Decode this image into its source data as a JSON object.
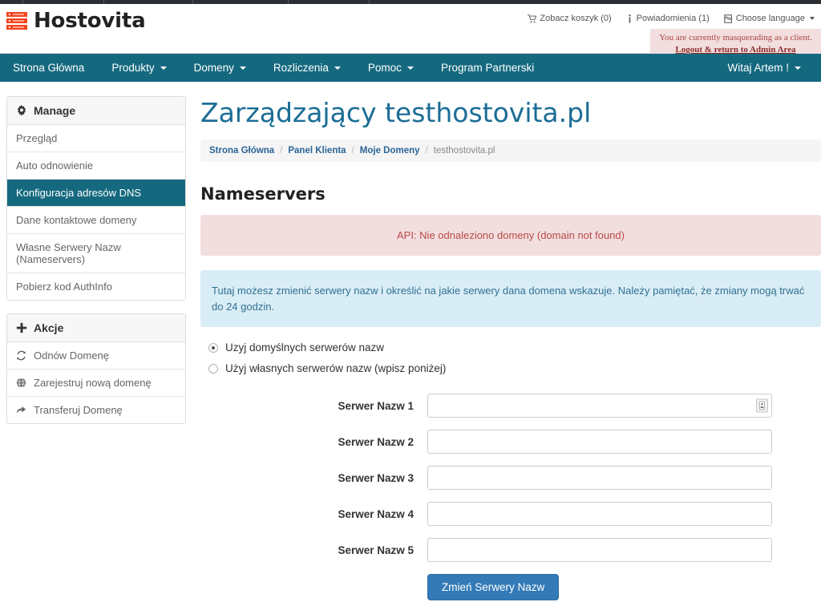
{
  "brand": {
    "name": "Hostovita",
    "logo_icon": "server-rack-icon",
    "logo_color": "#f4441e"
  },
  "topbar": {
    "links": [
      {
        "label": "Zobacz koszyk (0)",
        "icon": "shopping-cart-icon"
      },
      {
        "label": "Powiadomienia (1)",
        "icon": "info-icon"
      },
      {
        "label": "Choose language",
        "icon": "flag-icon",
        "caret": true
      }
    ]
  },
  "masquerade": {
    "message": "You are currently masquerading as a client.",
    "link_label": "Logout & return to Admin Area"
  },
  "nav": {
    "items": [
      {
        "label": "Strona Główna",
        "caret": false
      },
      {
        "label": "Produkty",
        "caret": true
      },
      {
        "label": "Domeny",
        "caret": true
      },
      {
        "label": "Rozliczenia",
        "caret": true
      },
      {
        "label": "Pomoc",
        "caret": true
      },
      {
        "label": "Program Partnerski",
        "caret": false
      }
    ],
    "user_label": "Witaj Artem !"
  },
  "sidebar": {
    "manage": {
      "title": "Manage",
      "icon": "gear-icon",
      "items": [
        {
          "label": "Przegląd",
          "active": false
        },
        {
          "label": "Auto odnowienie",
          "active": false
        },
        {
          "label": "Konfiguracja adresów DNS",
          "active": true
        },
        {
          "label": "Dane kontaktowe domeny",
          "active": false
        },
        {
          "label": "Własne Serwery Nazw (Nameservers)",
          "active": false
        },
        {
          "label": "Pobierz kod AuthInfo",
          "active": false
        }
      ]
    },
    "actions": {
      "title": "Akcje",
      "icon": "plus-icon",
      "items": [
        {
          "label": "Odnów Domenę",
          "icon": "refresh-icon"
        },
        {
          "label": "Zarejestruj nową domenę",
          "icon": "globe-icon"
        },
        {
          "label": "Transferuj Domenę",
          "icon": "share-arrow-icon"
        }
      ]
    }
  },
  "main": {
    "title": "Zarządzający testhostovita.pl",
    "breadcrumb": [
      {
        "label": "Strona Główna",
        "link": true
      },
      {
        "label": "Panel Klienta",
        "link": true
      },
      {
        "label": "Moje Domeny",
        "link": true
      },
      {
        "label": "testhostovita.pl",
        "link": false
      }
    ],
    "breadcrumb_separator": "/",
    "section_title": "Nameservers",
    "alert_danger": "API: Nie odnaleziono domeny (domain not found)",
    "alert_info": "Tutaj możesz zmienić serwery nazw i określić na jakie serwery dana domena wskazuje. Należy pamiętać, że zmiany mogą trwać do 24 godzin.",
    "radios": [
      {
        "label": "Uzyj domyślnych serwerów nazw",
        "checked": true
      },
      {
        "label": "Użyj własnych serwerów nazw (wpisz poniżej)",
        "checked": false
      }
    ],
    "fields": [
      {
        "label": "Serwer Nazw 1",
        "value": "",
        "placeholder": "",
        "autofill_icon": true
      },
      {
        "label": "Serwer Nazw 2",
        "value": "",
        "placeholder": "",
        "autofill_icon": false
      },
      {
        "label": "Serwer Nazw 3",
        "value": "",
        "placeholder": "",
        "autofill_icon": false
      },
      {
        "label": "Serwer Nazw 4",
        "value": "",
        "placeholder": "",
        "autofill_icon": false
      },
      {
        "label": "Serwer Nazw 5",
        "value": "",
        "placeholder": "",
        "autofill_icon": false
      }
    ],
    "submit_label": "Zmień Serwery Nazw"
  },
  "colors": {
    "navbar": "#15697f",
    "title": "#1b6d96",
    "primary_button": "#337ab7",
    "alert_danger_bg": "#f2dede",
    "alert_info_bg": "#d9edf7"
  }
}
